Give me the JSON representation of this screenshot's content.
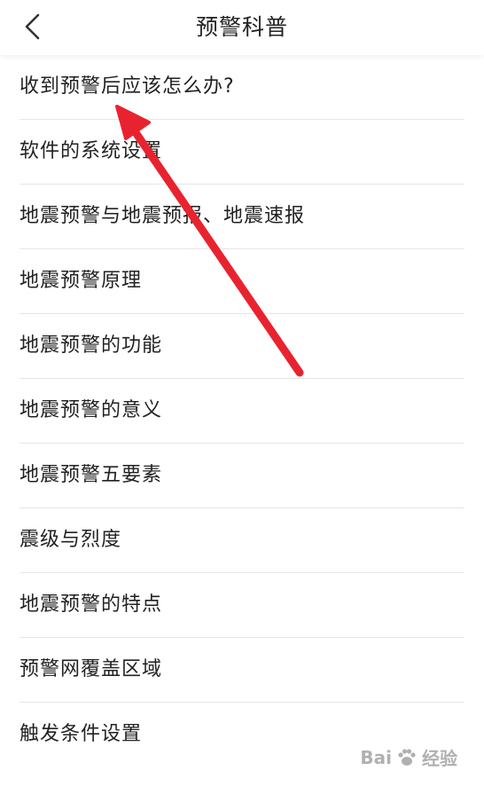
{
  "header": {
    "title": "预警科普",
    "back_icon": "chevron-left-icon"
  },
  "list": {
    "items": [
      {
        "label": "收到预警后应该怎么办?"
      },
      {
        "label": "软件的系统设置"
      },
      {
        "label": "地震预警与地震预报、地震速报"
      },
      {
        "label": "地震预警原理"
      },
      {
        "label": "地震预警的功能"
      },
      {
        "label": "地震预警的意义"
      },
      {
        "label": "地震预警五要素"
      },
      {
        "label": "震级与烈度"
      },
      {
        "label": "地震预警的特点"
      },
      {
        "label": "预警网覆盖区域"
      },
      {
        "label": "触发条件设置"
      }
    ]
  },
  "annotation": {
    "icon": "red-arrow-icon",
    "color": "#e8232f"
  },
  "watermark": {
    "text_latin": "Bai",
    "text_suffix": "经验",
    "icon": "baidu-paw-icon"
  }
}
